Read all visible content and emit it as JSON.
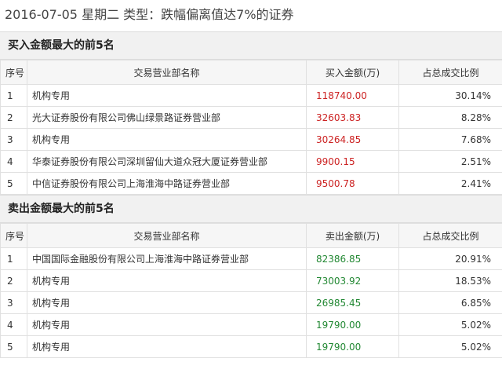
{
  "title": "2016-07-05 星期二  类型：跌幅偏离值达7%的证券",
  "buy_section": {
    "header": "买入金额最大的前5名",
    "columns": [
      "序号",
      "交易营业部名称",
      "买入金额(万)",
      "占总成交比例"
    ],
    "rows": [
      {
        "seq": "1",
        "dept": "机构专用",
        "amount": "118740.00",
        "pct": "30.14%"
      },
      {
        "seq": "2",
        "dept": "光大证券股份有限公司佛山绿景路证券营业部",
        "amount": "32603.83",
        "pct": "8.28%"
      },
      {
        "seq": "3",
        "dept": "机构专用",
        "amount": "30264.85",
        "pct": "7.68%"
      },
      {
        "seq": "4",
        "dept": "华泰证券股份有限公司深圳留仙大道众冠大厦证券营业部",
        "amount": "9900.15",
        "pct": "2.51%"
      },
      {
        "seq": "5",
        "dept": "中信证券股份有限公司上海淮海中路证券营业部",
        "amount": "9500.78",
        "pct": "2.41%"
      }
    ]
  },
  "sell_section": {
    "header": "卖出金额最大的前5名",
    "columns": [
      "序号",
      "交易营业部名称",
      "卖出金额(万)",
      "占总成交比例"
    ],
    "rows": [
      {
        "seq": "1",
        "dept": "中国国际金融股份有限公司上海淮海中路证券营业部",
        "amount": "82386.85",
        "pct": "20.91%"
      },
      {
        "seq": "2",
        "dept": "机构专用",
        "amount": "73003.92",
        "pct": "18.53%"
      },
      {
        "seq": "3",
        "dept": "机构专用",
        "amount": "26985.45",
        "pct": "6.85%"
      },
      {
        "seq": "4",
        "dept": "机构专用",
        "amount": "19790.00",
        "pct": "5.02%"
      },
      {
        "seq": "5",
        "dept": "机构专用",
        "amount": "19790.00",
        "pct": "5.02%"
      }
    ]
  },
  "colors": {
    "buy_amount": "#cc2222",
    "sell_amount": "#228833"
  }
}
